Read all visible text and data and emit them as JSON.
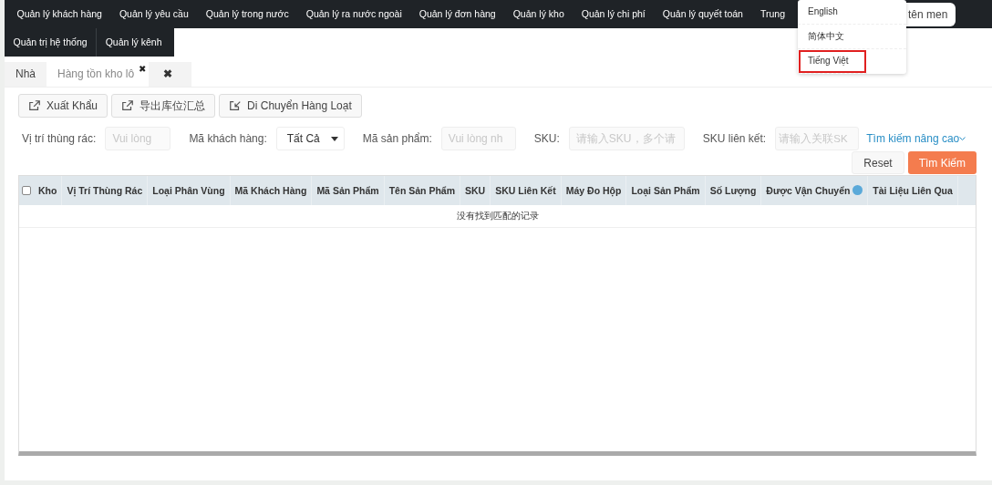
{
  "nav": {
    "items": [
      {
        "label": "Quản lý khách hàng"
      },
      {
        "label": "Quản lý yêu cầu"
      },
      {
        "label": "Quản lý trong nước"
      },
      {
        "label": "Quản lý ra nước ngoài"
      },
      {
        "label": "Quản lý đơn hàng"
      },
      {
        "label": "Quản lý kho"
      },
      {
        "label": "Quản lý chi phí"
      },
      {
        "label": "Quản lý quyết toán"
      },
      {
        "label": "Trung"
      }
    ],
    "items_row2": [
      {
        "label": "Quản trị hệ thống"
      },
      {
        "label": "Quản lý kênh"
      }
    ],
    "search": {
      "placeholder": "tên men"
    }
  },
  "language_menu": [
    {
      "label": "English",
      "selected": false
    },
    {
      "label": "简体中文",
      "selected": false
    },
    {
      "label": "Tiếng Việt",
      "selected": true
    }
  ],
  "tabs": [
    {
      "label": "Nhà",
      "selected": false
    },
    {
      "label": "Hàng tồn kho lô",
      "selected": true,
      "close": "✖"
    },
    {
      "label": "✖",
      "selected": false
    }
  ],
  "toolbar": [
    {
      "label": "Xuất Khẩu"
    },
    {
      "label": "导出库位汇总"
    },
    {
      "label": "Di Chuyển Hàng Loạt"
    }
  ],
  "filters": [
    {
      "label": "Vị trí thùng rác:",
      "kind": "input",
      "placeholder": "Vui lòng"
    },
    {
      "label": "Mã khách hàng:",
      "kind": "select",
      "value": "Tất Cả"
    },
    {
      "label": "Mã sản phẩm:",
      "kind": "input",
      "placeholder": "Vui lòng nh"
    },
    {
      "label": "SKU:",
      "kind": "input",
      "placeholder": "请输入SKU，多个请"
    },
    {
      "label": "SKU liên kết:",
      "kind": "input",
      "placeholder": "请输入关联SK"
    }
  ],
  "advanced_search": "Tìm kiếm nâng cao",
  "reset_button": "Reset",
  "search_button": "Tìm Kiếm",
  "table": {
    "columns": [
      {
        "label": "Kho",
        "help": false
      },
      {
        "label": "Vị Trí Thùng Rác",
        "help": false
      },
      {
        "label": "Loại Phân Vùng",
        "help": false
      },
      {
        "label": "Mã Khách Hàng",
        "help": false
      },
      {
        "label": "Mã Sản Phẩm",
        "help": false
      },
      {
        "label": "Tên Sản Phẩm",
        "help": false
      },
      {
        "label": "SKU",
        "help": false
      },
      {
        "label": "SKU Liên Kết",
        "help": false
      },
      {
        "label": "Máy Đo Hộp",
        "help": false
      },
      {
        "label": "Loại Sản Phẩm",
        "help": false
      },
      {
        "label": "Số Lượng",
        "help": false
      },
      {
        "label": "Được Vận Chuyển",
        "help": true
      },
      {
        "label": "Tài Liệu Liên Qua",
        "help": false
      }
    ],
    "select_all_checked": false,
    "empty_message": "没有找到匹配的记录"
  }
}
